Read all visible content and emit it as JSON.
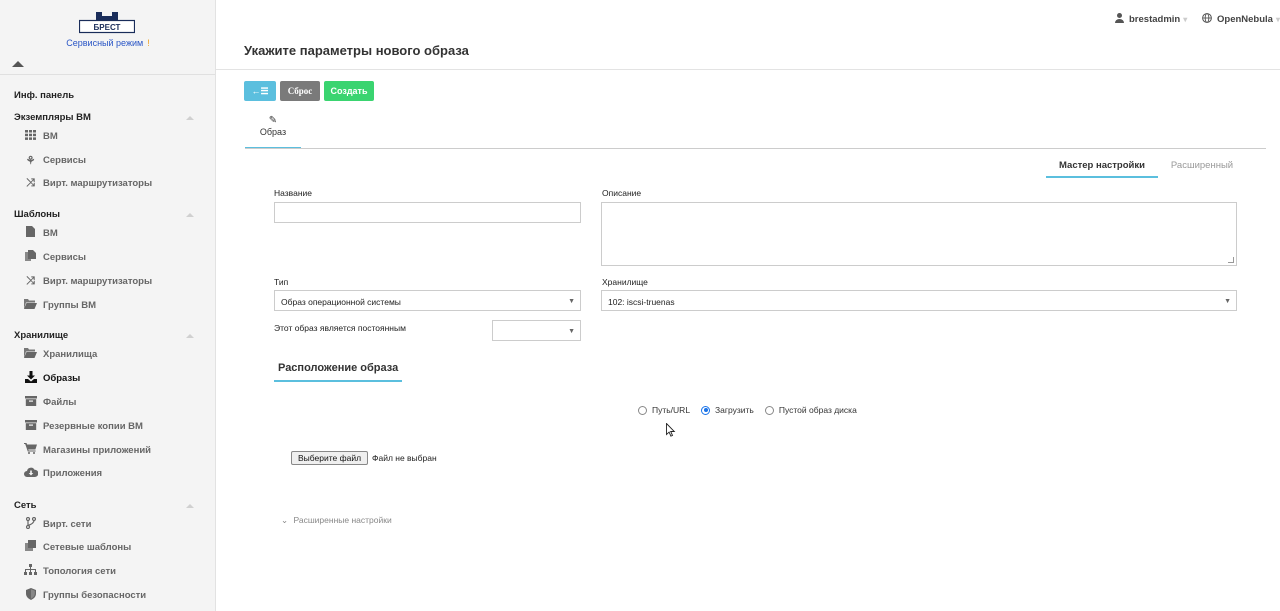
{
  "logo": {
    "text": "БРЕСТ"
  },
  "sidebar": {
    "mode": "Сервисный режим",
    "mode_alert": "!",
    "dashboard": "Инф. панель",
    "sections": [
      {
        "title": "Экземпляры ВМ",
        "items": [
          {
            "label": "ВМ",
            "icon": "grid-icon"
          },
          {
            "label": "Сервисы",
            "icon": "services-icon"
          },
          {
            "label": "Вирт. маршрутизаторы",
            "icon": "shuffle-icon"
          }
        ]
      },
      {
        "title": "Шаблоны",
        "items": [
          {
            "label": "ВМ",
            "icon": "file-icon"
          },
          {
            "label": "Сервисы",
            "icon": "files-icon"
          },
          {
            "label": "Вирт. маршрутизаторы",
            "icon": "shuffle-icon"
          },
          {
            "label": "Группы ВМ",
            "icon": "folder-open-icon"
          }
        ]
      },
      {
        "title": "Хранилище",
        "items": [
          {
            "label": "Хранилища",
            "icon": "folder-open-icon"
          },
          {
            "label": "Образы",
            "icon": "download-icon"
          },
          {
            "label": "Файлы",
            "icon": "archive-icon"
          },
          {
            "label": "Резервные копии ВМ",
            "icon": "archive-icon"
          },
          {
            "label": "Магазины приложений",
            "icon": "cart-icon"
          },
          {
            "label": "Приложения",
            "icon": "cloud-download-icon"
          }
        ]
      },
      {
        "title": "Сеть",
        "items": [
          {
            "label": "Вирт. сети",
            "icon": "branch-icon"
          },
          {
            "label": "Сетевые шаблоны",
            "icon": "clone-icon"
          },
          {
            "label": "Топология сети",
            "icon": "sitemap-icon"
          },
          {
            "label": "Группы безопасности",
            "icon": "shield-icon"
          }
        ]
      }
    ]
  },
  "header": {
    "user": "brestadmin",
    "zone": "OpenNebula",
    "title": "Укажите параметры нового образа"
  },
  "toolbar": {
    "back_icon": "←☰",
    "reset": "Сброс",
    "create": "Создать"
  },
  "tabs": {
    "image": "Образ",
    "wizard": "Мастер настройки",
    "advanced": "Расширенный"
  },
  "form": {
    "name_label": "Название",
    "name_value": "",
    "desc_label": "Описание",
    "desc_value": "",
    "type_label": "Тип",
    "type_value": "Образ операционной системы",
    "datastore_label": "Хранилище",
    "datastore_value": "102: iscsi-truenas",
    "persistent_label": "Этот образ является постоянным",
    "persistent_value": "",
    "location_title": "Расположение образа",
    "radio_path": "Путь/URL",
    "radio_upload": "Загрузить",
    "radio_empty": "Пустой образ диска",
    "file_button": "Выберите файл",
    "file_status": "Файл не выбран",
    "advanced_settings": "Расширенные настройки"
  },
  "colors": {
    "accent": "#5bbfde",
    "create": "#3ad470",
    "reset": "#7a7a7a",
    "sidebar_bg": "#f4f4f4",
    "mode": "#2a56c6"
  }
}
